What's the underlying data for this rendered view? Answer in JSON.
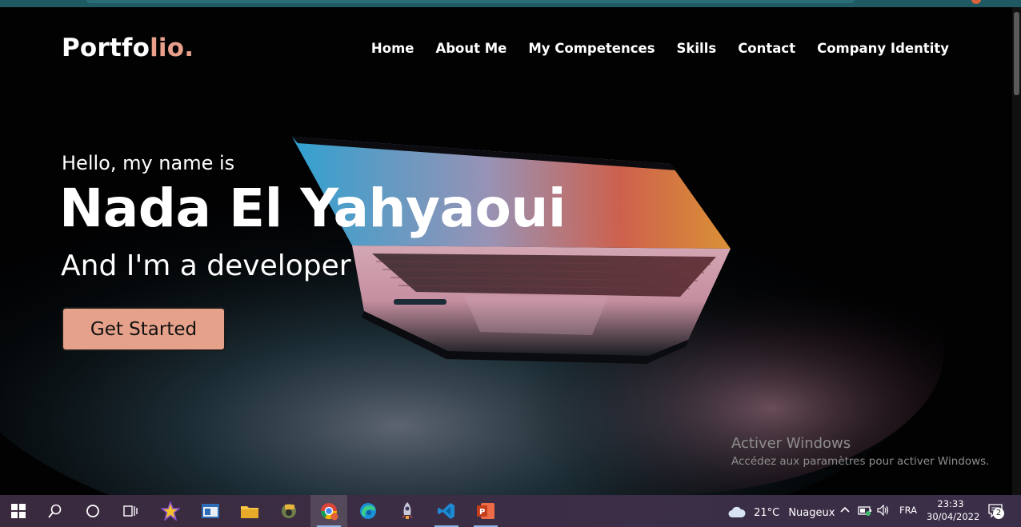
{
  "browser": {
    "accent": "#1f5a63"
  },
  "site": {
    "logo_main": "Portfo",
    "logo_accent": "lio.",
    "accent_color": "#e8a08b",
    "nav": [
      "Home",
      "About Me",
      "My Competences",
      "Skills",
      "Contact",
      "Company Identity"
    ]
  },
  "hero": {
    "greeting": "Hello, my name is",
    "name": "Nada El Yahyaoui",
    "role": "And I'm a developer",
    "cta": "Get Started"
  },
  "watermark": {
    "title": "Activer Windows",
    "subtitle": "Accédez aux paramètres pour activer Windows."
  },
  "taskbar": {
    "icons": [
      "windows-start-icon",
      "search-icon",
      "cortana-icon",
      "task-view-icon",
      "star-app-icon",
      "window-app-icon",
      "file-explorer-icon",
      "app-icon",
      "chrome-icon",
      "edge-icon",
      "rocket-app-icon",
      "vscode-icon",
      "powerpoint-icon"
    ],
    "weather": "21°C",
    "weather_desc": "Nuageux",
    "language": "FRA",
    "time": "23:33",
    "date": "30/04/2022",
    "notifications": "2"
  }
}
